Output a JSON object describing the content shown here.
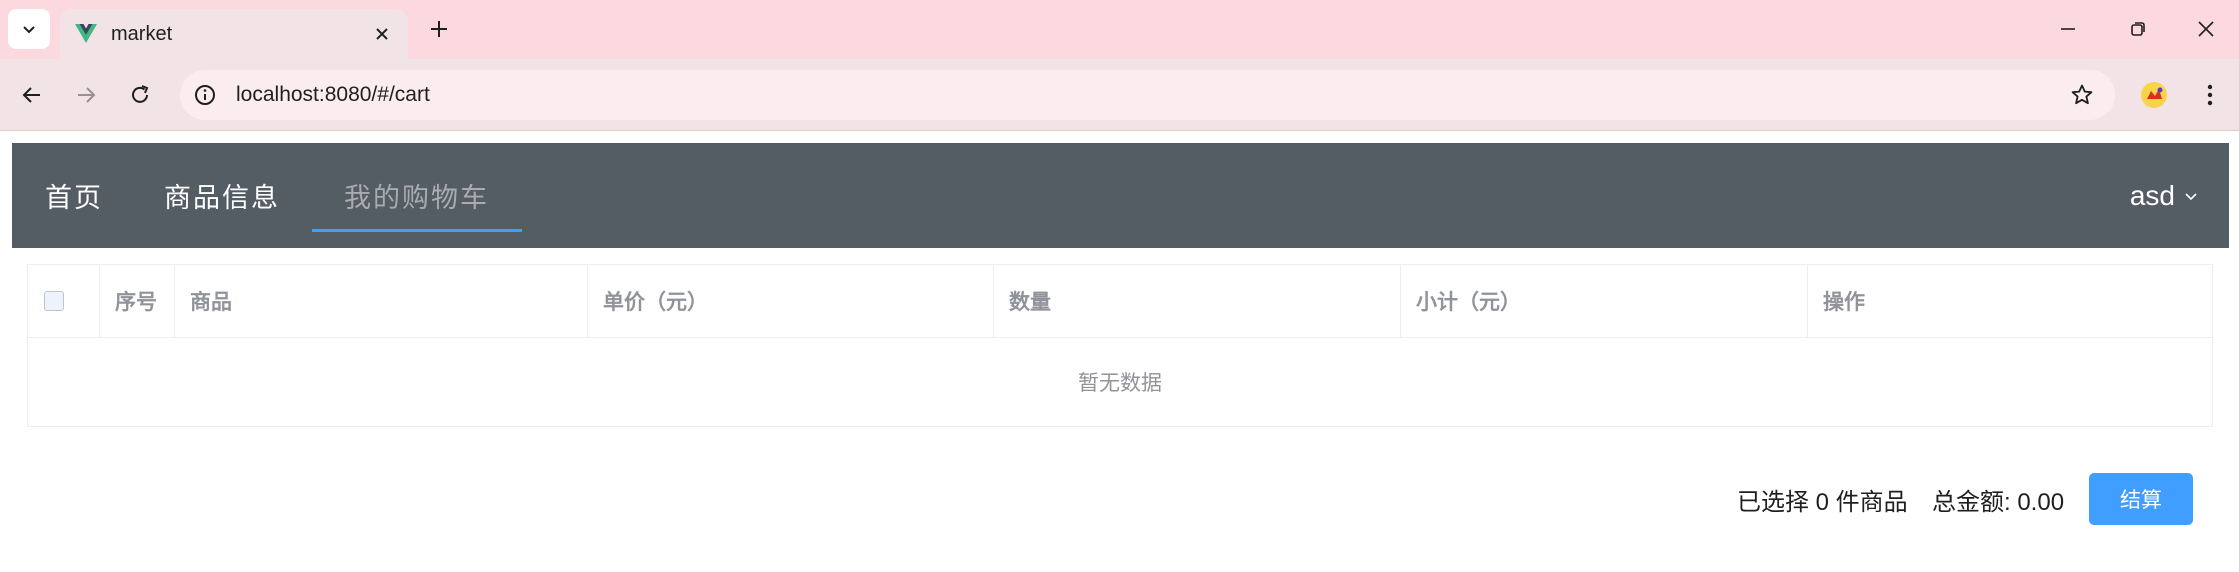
{
  "browser": {
    "tab": {
      "title": "market"
    },
    "address": {
      "url": "localhost:8080/#/cart"
    },
    "colors": {
      "tabbar_bg": "#fcd8df",
      "toolbar_bg": "#f1e3e6"
    }
  },
  "nav": {
    "items": [
      {
        "label": "首页",
        "active": false
      },
      {
        "label": "商品信息",
        "active": false
      },
      {
        "label": "我的购物车",
        "active": true
      }
    ],
    "user": "asd",
    "colors": {
      "bg": "#545c64",
      "active_underline": "#409eff"
    }
  },
  "table": {
    "columns": [
      "序号",
      "商品",
      "单价（元）",
      "数量",
      "小计（元）",
      "操作"
    ],
    "rows": [],
    "empty_text": "暂无数据"
  },
  "footer": {
    "selected_text": "已选择 0 件商品",
    "total_text": "总金额: 0.00",
    "checkout_label": "结算",
    "colors": {
      "button": "#409eff"
    }
  }
}
